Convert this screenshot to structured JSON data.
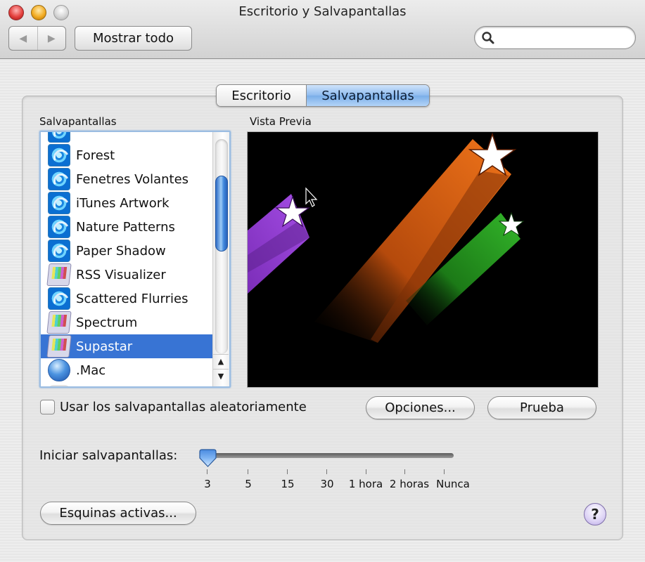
{
  "window": {
    "title": "Escritorio y Salvapantallas",
    "traffic_lights": [
      "close",
      "minimize",
      "zoom"
    ]
  },
  "toolbar": {
    "back_icon": "arrow-left-icon",
    "forward_icon": "arrow-right-icon",
    "show_all_label": "Mostrar todo",
    "search": {
      "value": "",
      "placeholder": "",
      "icon": "search-icon"
    }
  },
  "tabs": [
    {
      "label": "Escritorio",
      "selected": false
    },
    {
      "label": "Salvapantallas",
      "selected": true
    }
  ],
  "screensavers": {
    "label": "Salvapantallas",
    "items": [
      {
        "label": "",
        "icon": "swirl-icon",
        "partial": true
      },
      {
        "label": "Forest",
        "icon": "swirl-icon"
      },
      {
        "label": "Fenetres Volantes",
        "icon": "swirl-icon"
      },
      {
        "label": "iTunes Artwork",
        "icon": "swirl-icon"
      },
      {
        "label": "Nature Patterns",
        "icon": "swirl-icon"
      },
      {
        "label": "Paper Shadow",
        "icon": "swirl-icon"
      },
      {
        "label": "RSS Visualizer",
        "icon": "tv-test-pattern-icon"
      },
      {
        "label": "Scattered Flurries",
        "icon": "swirl-icon"
      },
      {
        "label": "Spectrum",
        "icon": "tv-test-pattern-icon"
      },
      {
        "label": "Supastar",
        "icon": "tv-test-pattern-icon",
        "selected": true
      },
      {
        "label": ".Mac",
        "icon": "globe-icon"
      },
      {
        "label": "",
        "icon": "cloud-icon",
        "partial": true
      }
    ],
    "scroll_up_icon": "▲",
    "scroll_down_icon": "▼"
  },
  "preview": {
    "label": "Vista Previa",
    "content": "Supastar shooting stars",
    "colors": {
      "background": "#000000",
      "purple": "#9b3fd8",
      "orange": "#e8660f",
      "green": "#2aa51f",
      "star": "#ffffff"
    }
  },
  "random": {
    "label": "Usar los salvapantallas aleatoriamente",
    "checked": false
  },
  "buttons": {
    "options": "Opciones...",
    "test": "Prueba",
    "hot_corners": "Esquinas activas...",
    "help": "?"
  },
  "start_slider": {
    "label": "Iniciar salvapantallas:",
    "ticks": [
      "3",
      "5",
      "15",
      "30",
      "1 hora",
      "2 horas",
      "Nunca"
    ],
    "selected_index": 0,
    "selected_value": "3"
  },
  "colors": {
    "selection": "#3874d4",
    "tab_selected": "#8ebbef",
    "help_button": "#dcd2f5"
  }
}
